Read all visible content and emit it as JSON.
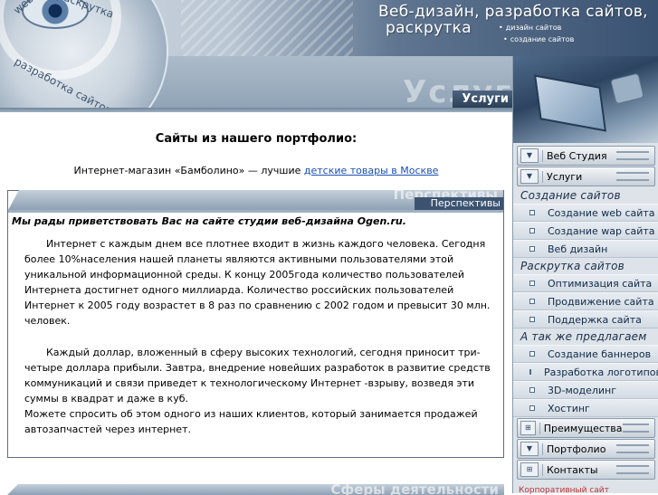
{
  "header": {
    "title_line1": "Веб-дизайн, разработка сайтов,",
    "title_line2": "раскрутка",
    "mini_links": [
      "дизайн сайтов",
      "создание сайтов"
    ],
    "logo_text": [
      "web дизайн",
      "раскрутка",
      "разработка сайтов"
    ],
    "section_ghost": "Услуги",
    "section_tab": "Услуги"
  },
  "main": {
    "portfolio_title": "Сайты из нашего портфолио:",
    "portfolio_prefix": "Интернет-магазин «Бамболино» — лучшие ",
    "portfolio_link": "детские товары в Москве",
    "panel": {
      "ghost": "Перспективы",
      "tab": "Перспективы",
      "welcome": "Мы рады приветствовать Вас на сайте студии веб-дизайна Ogen.ru.",
      "para1": "Интернет с каждым днем     все плотнее входит в жизнь каждого человека. Сегодня более    10%населения нашей планеты являются активными пользователями этой уникальной информационной среды. К концу  2005года количество пользователей  Интернета достигнет одного миллиарда.    Количество российских пользователей Интернет к 2005 году возрастет в 8 раз по сравнению с 2002 годом и превысит 30 млн. человек.",
      "para2": "Каждый доллар, вложенный в сферу высоких    технологий, сегодня приносит три-четыре доллара прибыли. Завтра, внедрение  новейших разработок в развитие средств коммуникаций и связи приведет к    технологическому Интернет  -взрыву, возведя эти суммы в квадрат и даже в куб.",
      "para3": "Можете спросить об этом одного из наших клиентов, который занимается продажей автозапчастей через интернет."
    },
    "panel2_ghost": "Сферы деятельности"
  },
  "sidebar": {
    "nav_top": [
      {
        "label": "Веб Студия",
        "icon": "chevron-down-icon",
        "glyph": "▼"
      },
      {
        "label": "Услуги",
        "icon": "chevron-down-icon",
        "glyph": "▼"
      }
    ],
    "groups": [
      {
        "title": "Создание сайтов",
        "items": [
          "Создание web сайта",
          "Создание wap сайта",
          "Веб дизайн"
        ]
      },
      {
        "title": "Раскрутка сайтов",
        "items": [
          "Оптимизация сайта",
          "Продвижение сайта",
          "Поддержка сайта"
        ]
      },
      {
        "title": "А так же предлагаем",
        "items": [
          "Создание баннеров",
          "Разработка логотипов",
          "3D-моделинг",
          "Хостинг"
        ]
      }
    ],
    "nav_bottom": [
      {
        "label": "Преимущества",
        "icon": "expand-icon",
        "glyph": "⊞"
      },
      {
        "label": "Портфолио",
        "icon": "chevron-down-icon",
        "glyph": "▼"
      },
      {
        "label": "Контакты",
        "icon": "expand-icon",
        "glyph": "⊞"
      }
    ],
    "bottom_text": "Корпоративный сайт"
  }
}
